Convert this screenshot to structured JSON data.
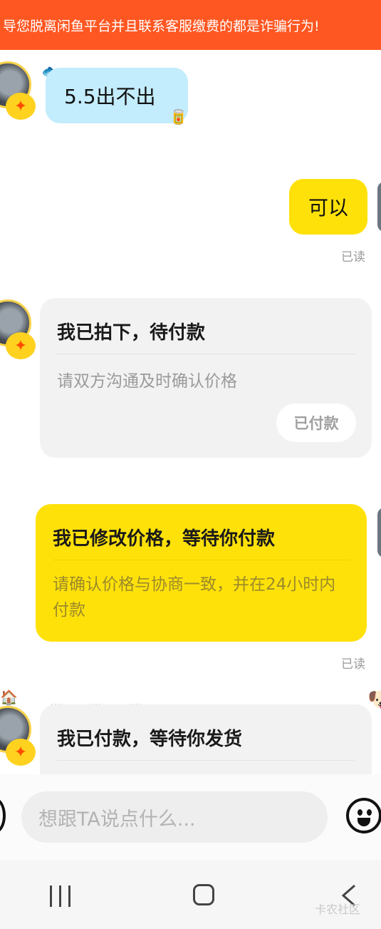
{
  "warning": {
    "text": "导您脱离闲鱼平台并且联系客服缴费的都是诈骗行为!"
  },
  "messages": {
    "m1": {
      "text": "5.5出不出"
    },
    "m2": {
      "text": "可以",
      "status": "已读"
    },
    "card1": {
      "title": "我已拍下，待付款",
      "desc": "请双方沟通及时确认价格",
      "button": "已付款"
    },
    "card2": {
      "title": "我已修改价格，等待你付款",
      "desc": "请确认价格与协商一致，并在24小时内付款",
      "status": "已读"
    },
    "card3": {
      "title": "我已付款，等待你发货"
    }
  },
  "input": {
    "placeholder": "想跟TA说点什么..."
  },
  "watermark": {
    "text": "卡农社区"
  },
  "colors": {
    "banner": "#ff5722",
    "incoming_bubble": "#c3ecfc",
    "outgoing_bubble": "#ffe10a",
    "card_gray": "#f2f2f3"
  }
}
